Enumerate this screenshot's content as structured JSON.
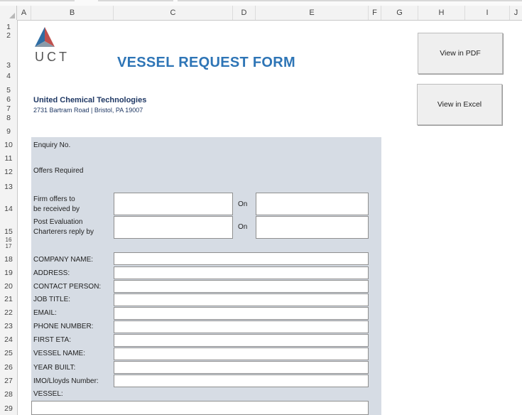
{
  "columns": [
    "A",
    "B",
    "C",
    "D",
    "E",
    "F",
    "G",
    "H",
    "I",
    "J"
  ],
  "rows": [
    "1",
    "2",
    "3",
    "4",
    "5",
    "6",
    "7",
    "8",
    "9",
    "10",
    "11",
    "12",
    "13",
    "14",
    "15",
    "16",
    "17",
    "18",
    "19",
    "20",
    "21",
    "22",
    "23",
    "24",
    "25",
    "26",
    "27",
    "28",
    "29"
  ],
  "logo": {
    "text": "UCT"
  },
  "form": {
    "title": "VESSEL REQUEST FORM",
    "company_name": "United Chemical Technologies",
    "company_address": "2731 Bartram Road | Bristol, PA 19007"
  },
  "buttons": {
    "pdf": "View in PDF",
    "excel": "View in Excel"
  },
  "labels": {
    "enquiry_no": "Enquiry No.",
    "offers_required": "Offers Required",
    "firm_offers_1": "Firm offers to",
    "firm_offers_2": "be received by",
    "post_eval_1": "Post Evaluation",
    "post_eval_2": "Charterers reply by",
    "on_1": "On",
    "on_2": "On",
    "company_name": "COMPANY NAME:",
    "address": "ADDRESS:",
    "contact_person": "CONTACT PERSON:",
    "job_title": "JOB TITLE:",
    "email": "EMAIL:",
    "phone_number": "PHONE NUMBER:",
    "first_eta": "FIRST ETA:",
    "vessel_name": "VESSEL NAME:",
    "year_built": "YEAR BUILT:",
    "imo_lloyds": "IMO/Lloyds Number:",
    "vessel": "VESSEL:"
  },
  "fields": {
    "firm_offers": "",
    "firm_offers_on": "",
    "post_eval": "",
    "post_eval_on": "",
    "company_name": "",
    "address": "",
    "contact_person": "",
    "job_title": "",
    "email": "",
    "phone_number": "",
    "first_eta": "",
    "vessel_name": "",
    "year_built": "",
    "imo_lloyds": "",
    "vessel": ""
  },
  "colors": {
    "title": "#2e75b6",
    "company": "#1f3864",
    "panel": "#d6dce4"
  }
}
